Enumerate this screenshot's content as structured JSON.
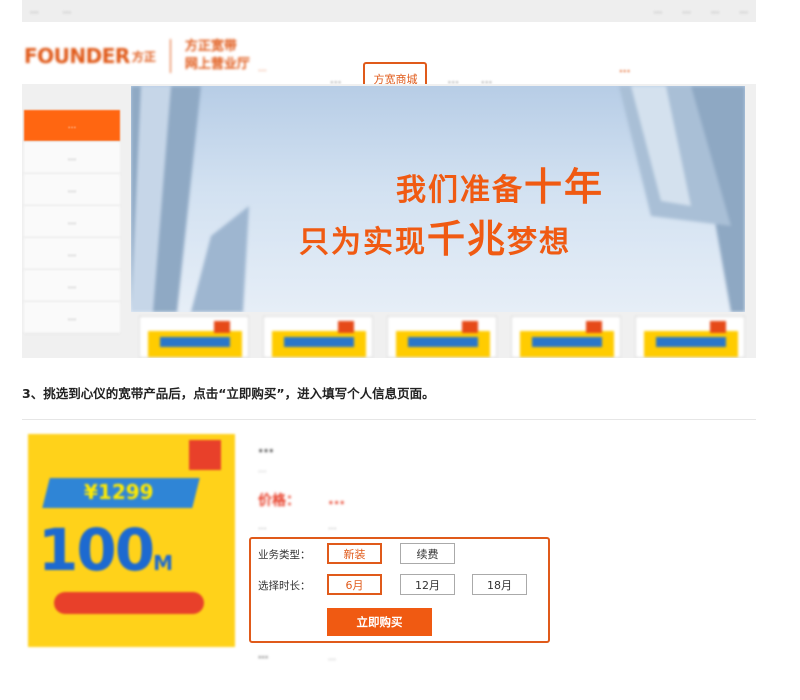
{
  "topbar": {
    "left": [
      "...",
      "..."
    ],
    "right": [
      "...",
      "...",
      "...",
      "..."
    ]
  },
  "header": {
    "logo_word": "FOUNDER",
    "logo_cn": "方正",
    "hall_line1": "方正宽带",
    "hall_line2": "网上营业厅",
    "city": "...",
    "nav": [
      "...",
      "方宽商城",
      "...",
      "..."
    ],
    "nav_active_index": 1,
    "hotline_line1": "...",
    "hotline_line2": "..."
  },
  "sidebar": [
    "...",
    "...",
    "...",
    "...",
    "...",
    "...",
    "..."
  ],
  "banner": {
    "slogan1_pre": "我们准备",
    "slogan1_big": "十年",
    "slogan2_pre": "只为实现",
    "slogan2_big": "千兆",
    "slogan2_post": "梦想"
  },
  "thumbs": 5,
  "step_text": "3、挑选到心仪的宽带产品后，点击“立即购买”，进入填写个人信息页面。",
  "product": {
    "image": {
      "price": "¥1299",
      "speed": "100",
      "unit": "M"
    },
    "title": "...",
    "subtitle": "...",
    "price_label": "价格：",
    "price_value": "...",
    "bandwidth_label": "...",
    "bandwidth_value": "...",
    "business_type_label": "业务类型：",
    "business_options": [
      "新装",
      "续费"
    ],
    "business_selected": 0,
    "duration_label": "选择时长：",
    "duration_options": [
      "6月",
      "12月",
      "18月"
    ],
    "duration_selected": 0,
    "buy_label": "立即购买",
    "desc_label": "...",
    "desc_text": "..."
  },
  "colors": {
    "accent": "#e05a1a",
    "buy": "#f05a12"
  }
}
